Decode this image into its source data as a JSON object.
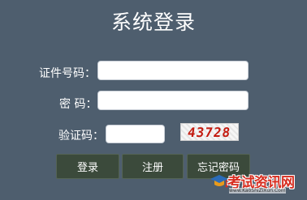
{
  "title": "系统登录",
  "form": {
    "id_label": "证件号码：",
    "id_value": "",
    "password_label": "密 码：",
    "password_value": "",
    "captcha_label": "验证码：",
    "captcha_value": "",
    "captcha_text": "43728"
  },
  "buttons": {
    "login": "登录",
    "register": "注册",
    "forgot": "忘记密码"
  },
  "watermark": {
    "text": "考试资讯网",
    "url": "www.KaoShiZiXun.Com"
  },
  "colors": {
    "background": "#4e5e6e",
    "button": "#3b4a3b",
    "captcha_text": "#c31b10",
    "watermark_red": "#d72d20"
  }
}
